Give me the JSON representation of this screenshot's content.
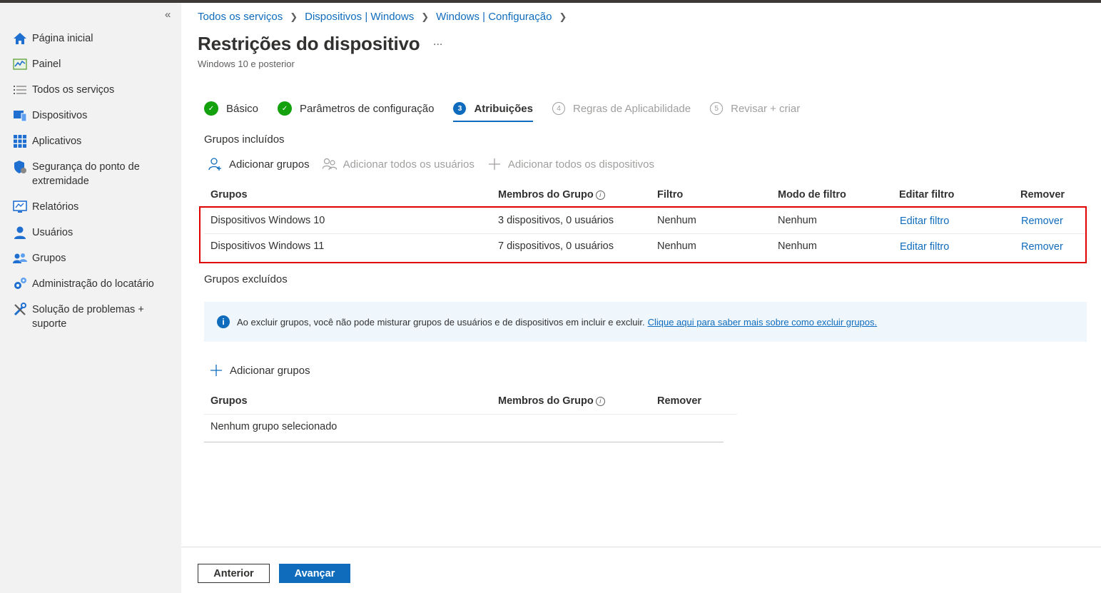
{
  "sidebar": {
    "collapse_glyph": "«",
    "items": [
      {
        "label": "Página inicial",
        "icon": "home-icon"
      },
      {
        "label": "Painel",
        "icon": "dashboard-icon"
      },
      {
        "label": "Todos os serviços",
        "icon": "list-icon"
      },
      {
        "label": "Dispositivos",
        "icon": "devices-icon"
      },
      {
        "label": "Aplicativos",
        "icon": "apps-icon"
      },
      {
        "label": "Segurança do ponto de extremidade",
        "icon": "shield-icon"
      },
      {
        "label": "Relatórios",
        "icon": "reports-icon"
      },
      {
        "label": "Usuários",
        "icon": "user-icon"
      },
      {
        "label": "Grupos",
        "icon": "groups-icon"
      },
      {
        "label": "Administração do locatário",
        "icon": "tenant-admin-icon"
      },
      {
        "label": "Solução de problemas + suporte",
        "icon": "troubleshoot-icon"
      }
    ]
  },
  "breadcrumb": [
    "Todos os serviços",
    "Dispositivos | Windows",
    "Windows | Configuração"
  ],
  "page": {
    "title": "Restrições do dispositivo",
    "more": "...",
    "subtitle": "Windows 10 e posterior"
  },
  "steps": [
    {
      "label": "Básico",
      "state": "done",
      "marker": "✓"
    },
    {
      "label": "Parâmetros de configuração",
      "state": "done",
      "marker": "✓"
    },
    {
      "label": "Atribuições",
      "state": "current",
      "marker": "3"
    },
    {
      "label": "Regras de Aplicabilidade",
      "state": "todo",
      "marker": "4"
    },
    {
      "label": "Revisar + criar",
      "state": "todo",
      "marker": "5"
    }
  ],
  "included": {
    "title": "Grupos incluídos",
    "commands": {
      "add_groups": "Adicionar grupos",
      "add_all_users": "Adicionar todos os usuários",
      "add_all_devices": "Adicionar todos os dispositivos"
    },
    "columns": {
      "groups": "Grupos",
      "members": "Membros do Grupo",
      "filter": "Filtro",
      "filter_mode": "Modo de filtro",
      "edit_filter": "Editar filtro",
      "remove": "Remover"
    },
    "rows": [
      {
        "group": "Dispositivos Windows 10",
        "members": "3 dispositivos, 0 usuários",
        "filter": "Nenhum",
        "filter_mode": "Nenhum",
        "edit": "Editar filtro",
        "remove": "Remover"
      },
      {
        "group": "Dispositivos Windows 11",
        "members": "7 dispositivos, 0 usuários",
        "filter": "Nenhum",
        "filter_mode": "Nenhum",
        "edit": "Editar filtro",
        "remove": "Remover"
      }
    ]
  },
  "excluded": {
    "title": "Grupos excluídos",
    "info_text": "Ao excluir grupos, você não pode misturar grupos de usuários e de dispositivos em incluir e excluir.",
    "info_link": "Clique aqui para saber mais sobre como excluir grupos.",
    "add_groups": "Adicionar grupos",
    "columns": {
      "groups": "Grupos",
      "members": "Membros do Grupo",
      "remove": "Remover"
    },
    "empty": "Nenhum grupo selecionado"
  },
  "footer": {
    "previous": "Anterior",
    "next": "Avançar"
  },
  "colors": {
    "accent": "#0f6cbd",
    "success": "#13a10e",
    "highlight": "#e00000"
  }
}
